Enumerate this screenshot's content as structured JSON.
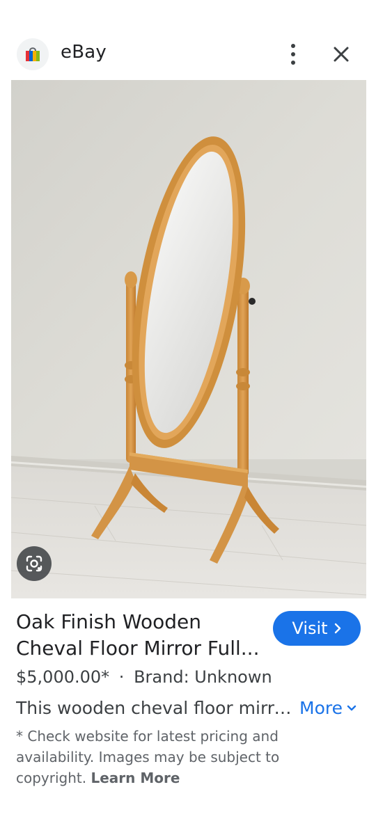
{
  "header": {
    "site_name": "eBay",
    "favicon_icon": "shopping-bag-icon",
    "menu_icon": "more-vert-icon",
    "close_icon": "close-icon"
  },
  "image": {
    "subject": "Wooden cheval floor mirror",
    "lens_icon": "google-lens-icon"
  },
  "product": {
    "title_line1": "Oak Finish Wooden",
    "title_line2": "Cheval Floor Mirror Full...",
    "visit_label": "Visit",
    "price": "$5,000.00*",
    "separator": "·",
    "brand": "Brand: Unknown",
    "description": "This wooden cheval floor mirror is a",
    "more_label": "More",
    "disclaimer": "* Check website for latest pricing and availability. Images may be subject to copyright.",
    "learn_more_label": "Learn More"
  },
  "colors": {
    "accent": "#1a73e8",
    "wood": "#d89a4a",
    "wall": "#d9d8d2"
  }
}
